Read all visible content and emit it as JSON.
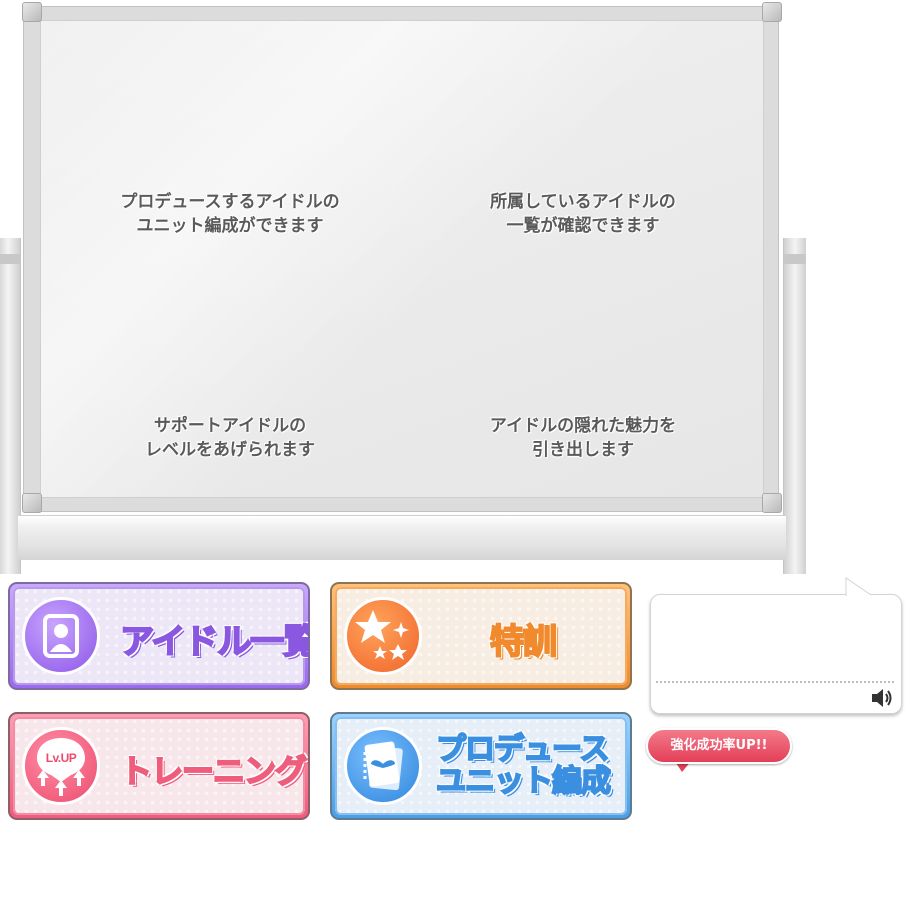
{
  "board": {
    "descriptions": {
      "unit": {
        "line1": "プロデュースするアイドルの",
        "line2": "ユニット編成ができます"
      },
      "idol_list": {
        "line1": "所属しているアイドルの",
        "line2": "一覧が確認できます"
      },
      "training": {
        "line1": "サポートアイドルの",
        "line2": "レベルをあげられます"
      },
      "tokkun": {
        "line1": "アイドルの隠れた魅力を",
        "line2": "引き出します"
      }
    }
  },
  "menu": {
    "idol_list": {
      "label": "アイドル一覧",
      "icon": "portrait-icon",
      "color": "#9a6af0"
    },
    "tokkun": {
      "label": "特訓",
      "icon": "stars-icon",
      "color": "#f08a2c"
    },
    "training": {
      "label": "トレーニング",
      "icon": "level-up-icon",
      "icon_text": "Lv.UP",
      "color": "#ef5d7d"
    },
    "produce_unit": {
      "label_line1": "プロデュース",
      "label_line2": "ユニット編成",
      "icon": "wing-notebook-icon",
      "color": "#4b9ee8"
    }
  },
  "speech_bubble": {
    "text": "",
    "audio_icon": "speaker-icon"
  },
  "badge": {
    "text": "強化成功率UP!!",
    "color": "#e33f58"
  }
}
